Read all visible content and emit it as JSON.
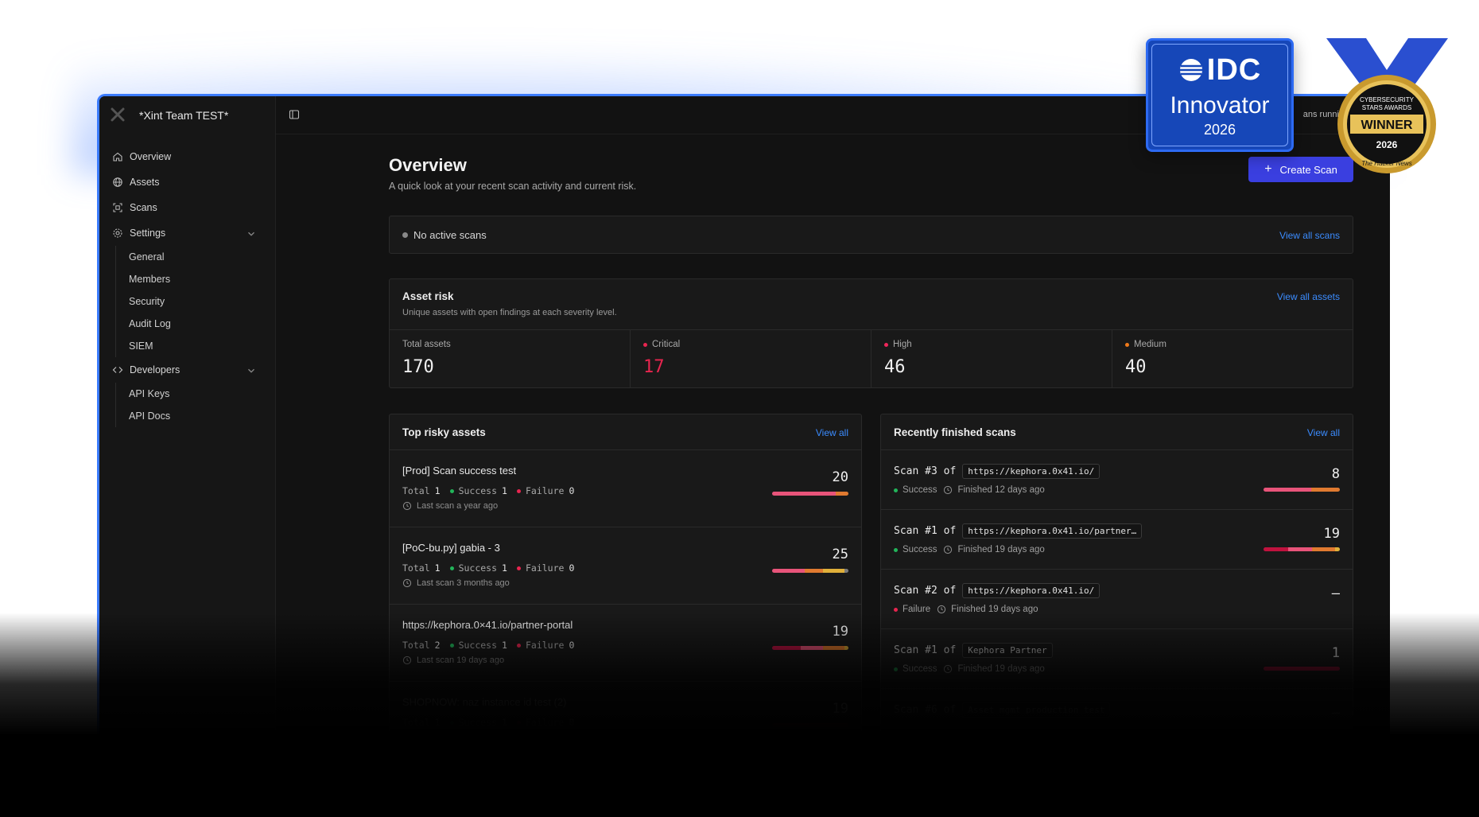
{
  "workspace": {
    "name": "*Xint Team TEST*"
  },
  "sidebar": {
    "items": [
      {
        "label": "Overview",
        "icon": "home-icon"
      },
      {
        "label": "Assets",
        "icon": "globe-icon"
      },
      {
        "label": "Scans",
        "icon": "scan-icon"
      },
      {
        "label": "Settings",
        "icon": "gear-icon"
      }
    ],
    "settings_sub": [
      "General",
      "Members",
      "Security",
      "Audit Log",
      "SIEM"
    ],
    "developers": {
      "label": "Developers",
      "icon": "code-icon"
    },
    "developers_sub": [
      "API Keys",
      "API Docs"
    ]
  },
  "topbar": {
    "running_text": "ans runni"
  },
  "page": {
    "title": "Overview",
    "subtitle": "A quick look at your recent scan activity and current risk.",
    "create_label": "Create Scan"
  },
  "active_scans": {
    "text": "No active scans",
    "link": "View all scans"
  },
  "asset_risk": {
    "title": "Asset risk",
    "subtitle": "Unique assets with open findings at each severity level.",
    "link": "View all assets",
    "stats": [
      {
        "label": "Total assets",
        "value": "170",
        "color": ""
      },
      {
        "label": "Critical",
        "value": "17",
        "color": "#e8254f"
      },
      {
        "label": "High",
        "value": "46",
        "color": "#f0265a"
      },
      {
        "label": "Medium",
        "value": "40",
        "color": "#f07a1a"
      }
    ]
  },
  "top_risky": {
    "title": "Top risky assets",
    "link": "View all",
    "meta_labels": {
      "total": "Total",
      "success": "Success",
      "failure": "Failure"
    },
    "rows": [
      {
        "name": "[Prod] Scan success test",
        "total": "1",
        "success": "1",
        "failure": "0",
        "last": "Last scan a year ago",
        "count": "20",
        "segments": [
          {
            "color": "#e8547a",
            "share": 0.83
          },
          {
            "color": "#e07a30",
            "share": 0.17
          }
        ]
      },
      {
        "name": "[PoC-bu.py] gabia - 3",
        "total": "1",
        "success": "1",
        "failure": "0",
        "last": "Last scan 3 months ago",
        "count": "25",
        "segments": [
          {
            "color": "#e8547a",
            "share": 0.43
          },
          {
            "color": "#e07a30",
            "share": 0.24
          },
          {
            "color": "#e0b03a",
            "share": 0.28
          },
          {
            "color": "#7a7a7a",
            "share": 0.05
          }
        ]
      },
      {
        "name": "https://kephora.0×41.io/partner-portal",
        "total": "2",
        "success": "1",
        "failure": "0",
        "last": "Last scan 19 days ago",
        "count": "19",
        "segments": [
          {
            "color": "#b0123e",
            "share": 0.37
          },
          {
            "color": "#d94e70",
            "share": 0.3
          },
          {
            "color": "#d0702a",
            "share": 0.28
          },
          {
            "color": "#c99a30",
            "share": 0.05
          }
        ]
      },
      {
        "name": "SHOPNOW: naz instance id test (2)",
        "total": "1",
        "success": "1",
        "failure": "0",
        "last": "",
        "count": "19",
        "segments": [
          {
            "color": "#b0123e",
            "share": 1.0
          }
        ]
      }
    ]
  },
  "recent_scans": {
    "title": "Recently finished scans",
    "link": "View all",
    "of_label": "of",
    "rows": [
      {
        "scan": "Scan #3",
        "target": "https://kephora.0x41.io/",
        "status": "Success",
        "status_color": "#22b55a",
        "finished": "Finished 12 days ago",
        "count": "8",
        "segments": [
          {
            "color": "#e8547a",
            "share": 0.62
          },
          {
            "color": "#e07a30",
            "share": 0.38
          }
        ]
      },
      {
        "scan": "Scan #1",
        "target": "https://kephora.0x41.io/partner…",
        "status": "Success",
        "status_color": "#22b55a",
        "finished": "Finished 19 days ago",
        "count": "19",
        "segments": [
          {
            "color": "#c0123e",
            "share": 0.32
          },
          {
            "color": "#e8547a",
            "share": 0.32
          },
          {
            "color": "#e07a30",
            "share": 0.3
          },
          {
            "color": "#e0b03a",
            "share": 0.06
          }
        ]
      },
      {
        "scan": "Scan #2",
        "target": "https://kephora.0x41.io/",
        "status": "Failure",
        "status_color": "#e8254f",
        "finished": "Finished 19 days ago",
        "count": "–",
        "segments": []
      },
      {
        "scan": "Scan #1",
        "target": "Kephora Partner",
        "status": "Success",
        "status_color": "#22b55a",
        "finished": "Finished 19 days ago",
        "count": "1",
        "segments": [
          {
            "color": "#a0123a",
            "share": 1.0
          }
        ]
      },
      {
        "scan": "Scan #6",
        "target": "Asset mgmt production test",
        "status": "",
        "status_color": "#22b55a",
        "finished": "",
        "count": "–",
        "segments": []
      }
    ]
  },
  "badges": {
    "idc": {
      "brand": "IDC",
      "title": "Innovator",
      "year": "2026"
    },
    "winner": {
      "top": "CYBERSECURITY",
      "mid": "STARS AWARDS",
      "label": "WINNER",
      "year": "2026",
      "ring": "The Hacker News"
    }
  }
}
